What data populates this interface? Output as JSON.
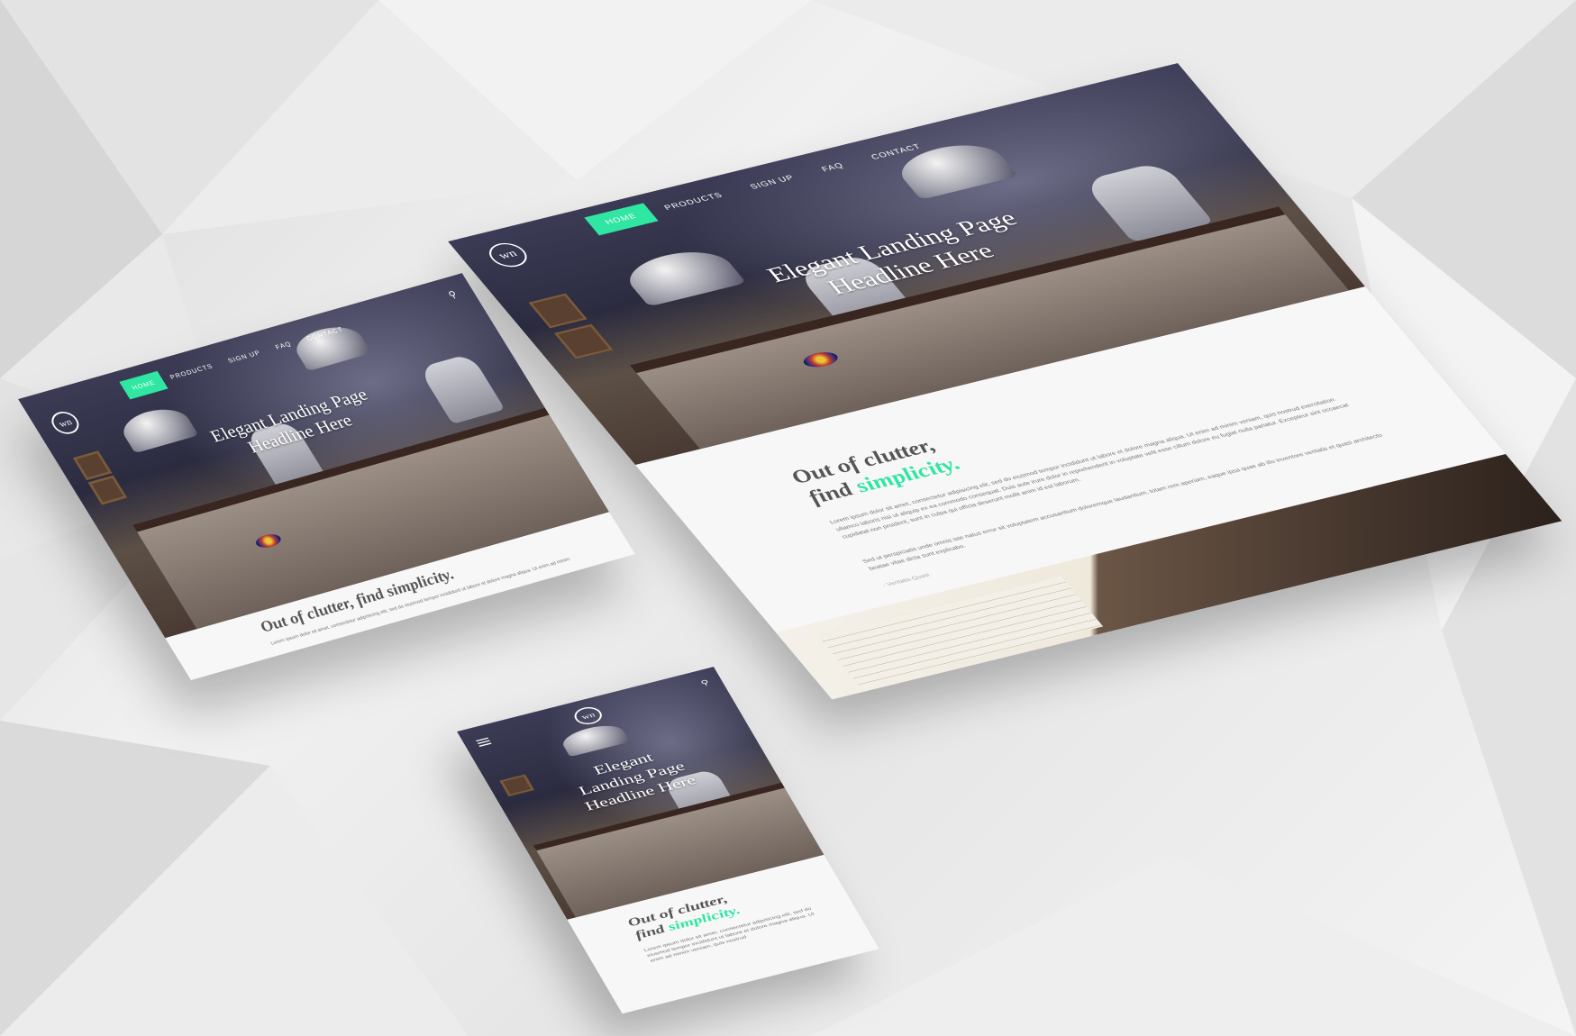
{
  "accent_color": "#2fe6a2",
  "desktop": {
    "nav": [
      "HOME",
      "PRODUCTS",
      "SIGN UP",
      "FAQ",
      "CONTACT"
    ],
    "logo": "wn",
    "headline_line1": "Elegant Landing Page",
    "headline_line2": "Headline Here",
    "tagline_part1": "Out of clutter,",
    "tagline_part2": "find",
    "tagline_accent": "simplicity.",
    "para1": "Lorem ipsum dolor sit amet, consectetur adipisicing elit, sed do eiusmod tempor incididunt ut labore et dolore magna aliqua. Ut enim ad minim veniam, quis nostrud exercitation ullamco laboris nisi ut aliquip ex ea commodo consequat. Duis aute irure dolor in reprehenderit in voluptate velit esse cillum dolore eu fugiat nulla pariatur. Excepteur sint occaecat cupidatat non proident, sunt in culpa qui officia deserunt mollit anim id est laborum.",
    "para2": "Sed ut perspiciatis unde omnis iste natus error sit voluptatem accusantium doloremque laudantium, totam rem aperiam, eaque ipsa quae ab illo inventore veritatis et quasi architecto beatae vitae dicta sunt explicabo.",
    "signature": "- Veritatis Quasi"
  },
  "tablet": {
    "nav": [
      "HOME",
      "PRODUCTS",
      "SIGN UP",
      "FAQ",
      "CONTACT"
    ],
    "logo": "wn",
    "headline_line1": "Elegant Landing Page",
    "headline_line2": "Headline Here",
    "tagline": "Out of clutter, find simplicity.",
    "para1": "Lorem ipsum dolor sit amet, consectetur adipisicing elit, sed do eiusmod tempor incididunt ut labore et dolore magna aliqua. Ut enim ad minim"
  },
  "mobile": {
    "logo": "wn",
    "headline_line1": "Elegant",
    "headline_line2": "Landing Page",
    "headline_line3": "Headline Here",
    "tagline_part1": "Out of clutter,",
    "tagline_part2": "find",
    "tagline_accent": "simplicity.",
    "para1": "Lorem ipsum dolor sit amet, consectetur adipisicing elit, sed do eiusmod tempor incididunt ut labore et dolore magna aliqua. Ut enim ad minim veniam, quis nostrud"
  }
}
